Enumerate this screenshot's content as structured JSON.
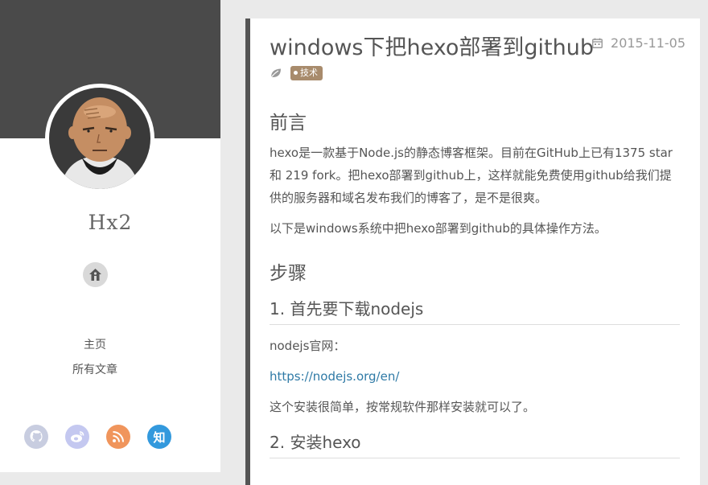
{
  "sidebar": {
    "site_name": "Hx2",
    "nav": [
      "主页",
      "所有文章"
    ],
    "social": [
      {
        "icon": "github-icon",
        "color": "#c8cde0"
      },
      {
        "icon": "weibo-icon",
        "color": "#c4c8f0"
      },
      {
        "icon": "rss-icon",
        "color": "#f0955c"
      },
      {
        "icon": "zhihu-icon",
        "label": "知",
        "color": "#3399dd"
      }
    ]
  },
  "post": {
    "title": "windows下把hexo部署到github",
    "date": "2015-11-05",
    "tag": "技术",
    "sections": {
      "preface_heading": "前言",
      "preface_p1": "hexo是一款基于Node.js的静态博客框架。目前在GitHub上已有1375 star 和 219 fork。把hexo部署到github上，这样就能免费使用github给我们提供的服务器和域名发布我们的博客了，是不是很爽。",
      "preface_p2": "以下是windows系统中把hexo部署到github的具体操作方法。",
      "steps_heading": "步骤",
      "step1_heading": "1. 首先要下载nodejs",
      "step1_p1": "nodejs官网：",
      "step1_link": "https://nodejs.org/en/",
      "step1_p2": "这个安装很简单，按常规软件那样安装就可以了。",
      "step2_heading": "2. 安装hexo"
    }
  },
  "colors": {
    "banner": "#4a4a4a",
    "tag": "#a88b6c",
    "link": "#2f7aa6"
  }
}
